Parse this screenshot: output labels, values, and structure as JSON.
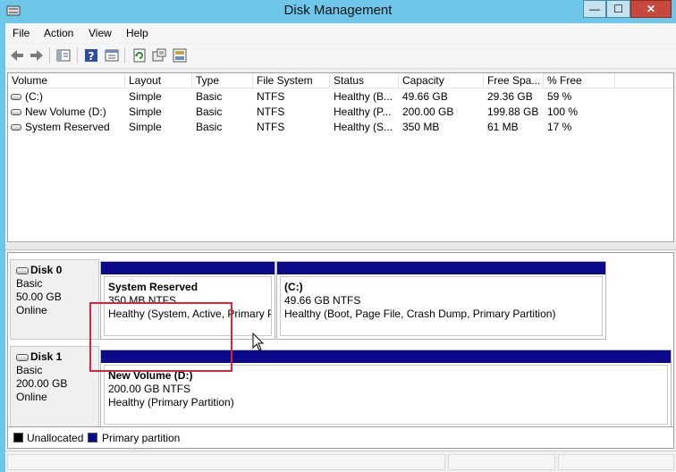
{
  "window": {
    "title": "Disk Management",
    "min_label": "—",
    "max_label": "☐",
    "close_label": "✕"
  },
  "menu": [
    "File",
    "Action",
    "View",
    "Help"
  ],
  "toolbar": {
    "icons": [
      "back-arrow-icon",
      "forward-arrow-icon",
      "console-tree-icon",
      "help-icon",
      "properties-icon",
      "refresh-icon",
      "rescan-icon",
      "export-icon"
    ]
  },
  "volumes": {
    "columns": [
      "Volume",
      "Layout",
      "Type",
      "File System",
      "Status",
      "Capacity",
      "Free Spa...",
      "% Free"
    ],
    "rows": [
      [
        "(C:)",
        "Simple",
        "Basic",
        "NTFS",
        "Healthy (B...",
        "49.66 GB",
        "29.36 GB",
        "59 %"
      ],
      [
        "New Volume (D:)",
        "Simple",
        "Basic",
        "NTFS",
        "Healthy (P...",
        "200.00 GB",
        "199.88 GB",
        "100 %"
      ],
      [
        "System Reserved",
        "Simple",
        "Basic",
        "NTFS",
        "Healthy (S...",
        "350 MB",
        "61 MB",
        "17 %"
      ]
    ]
  },
  "disks": [
    {
      "name": "Disk 0",
      "type": "Basic",
      "size": "50.00 GB",
      "state": "Online",
      "partitions": [
        {
          "name": "System Reserved",
          "size": "350 MB NTFS",
          "status": "Healthy (System, Active, Primary P"
        },
        {
          "name": "(C:)",
          "size": "49.66 GB NTFS",
          "status": "Healthy (Boot, Page File, Crash Dump, Primary Partition)"
        }
      ]
    },
    {
      "name": "Disk 1",
      "type": "Basic",
      "size": "200.00 GB",
      "state": "Online",
      "partitions": [
        {
          "name": "New Volume  (D:)",
          "size": "200.00 GB NTFS",
          "status": "Healthy (Primary Partition)"
        }
      ]
    }
  ],
  "legend": {
    "unallocated": {
      "label": "Unallocated",
      "color": "#000000"
    },
    "primary": {
      "label": "Primary partition",
      "color": "#0a0a8a"
    }
  },
  "colors": {
    "titlebar": "#6ec6e8",
    "partition_bar": "#0a0a8a",
    "highlight": "#d6283c"
  }
}
